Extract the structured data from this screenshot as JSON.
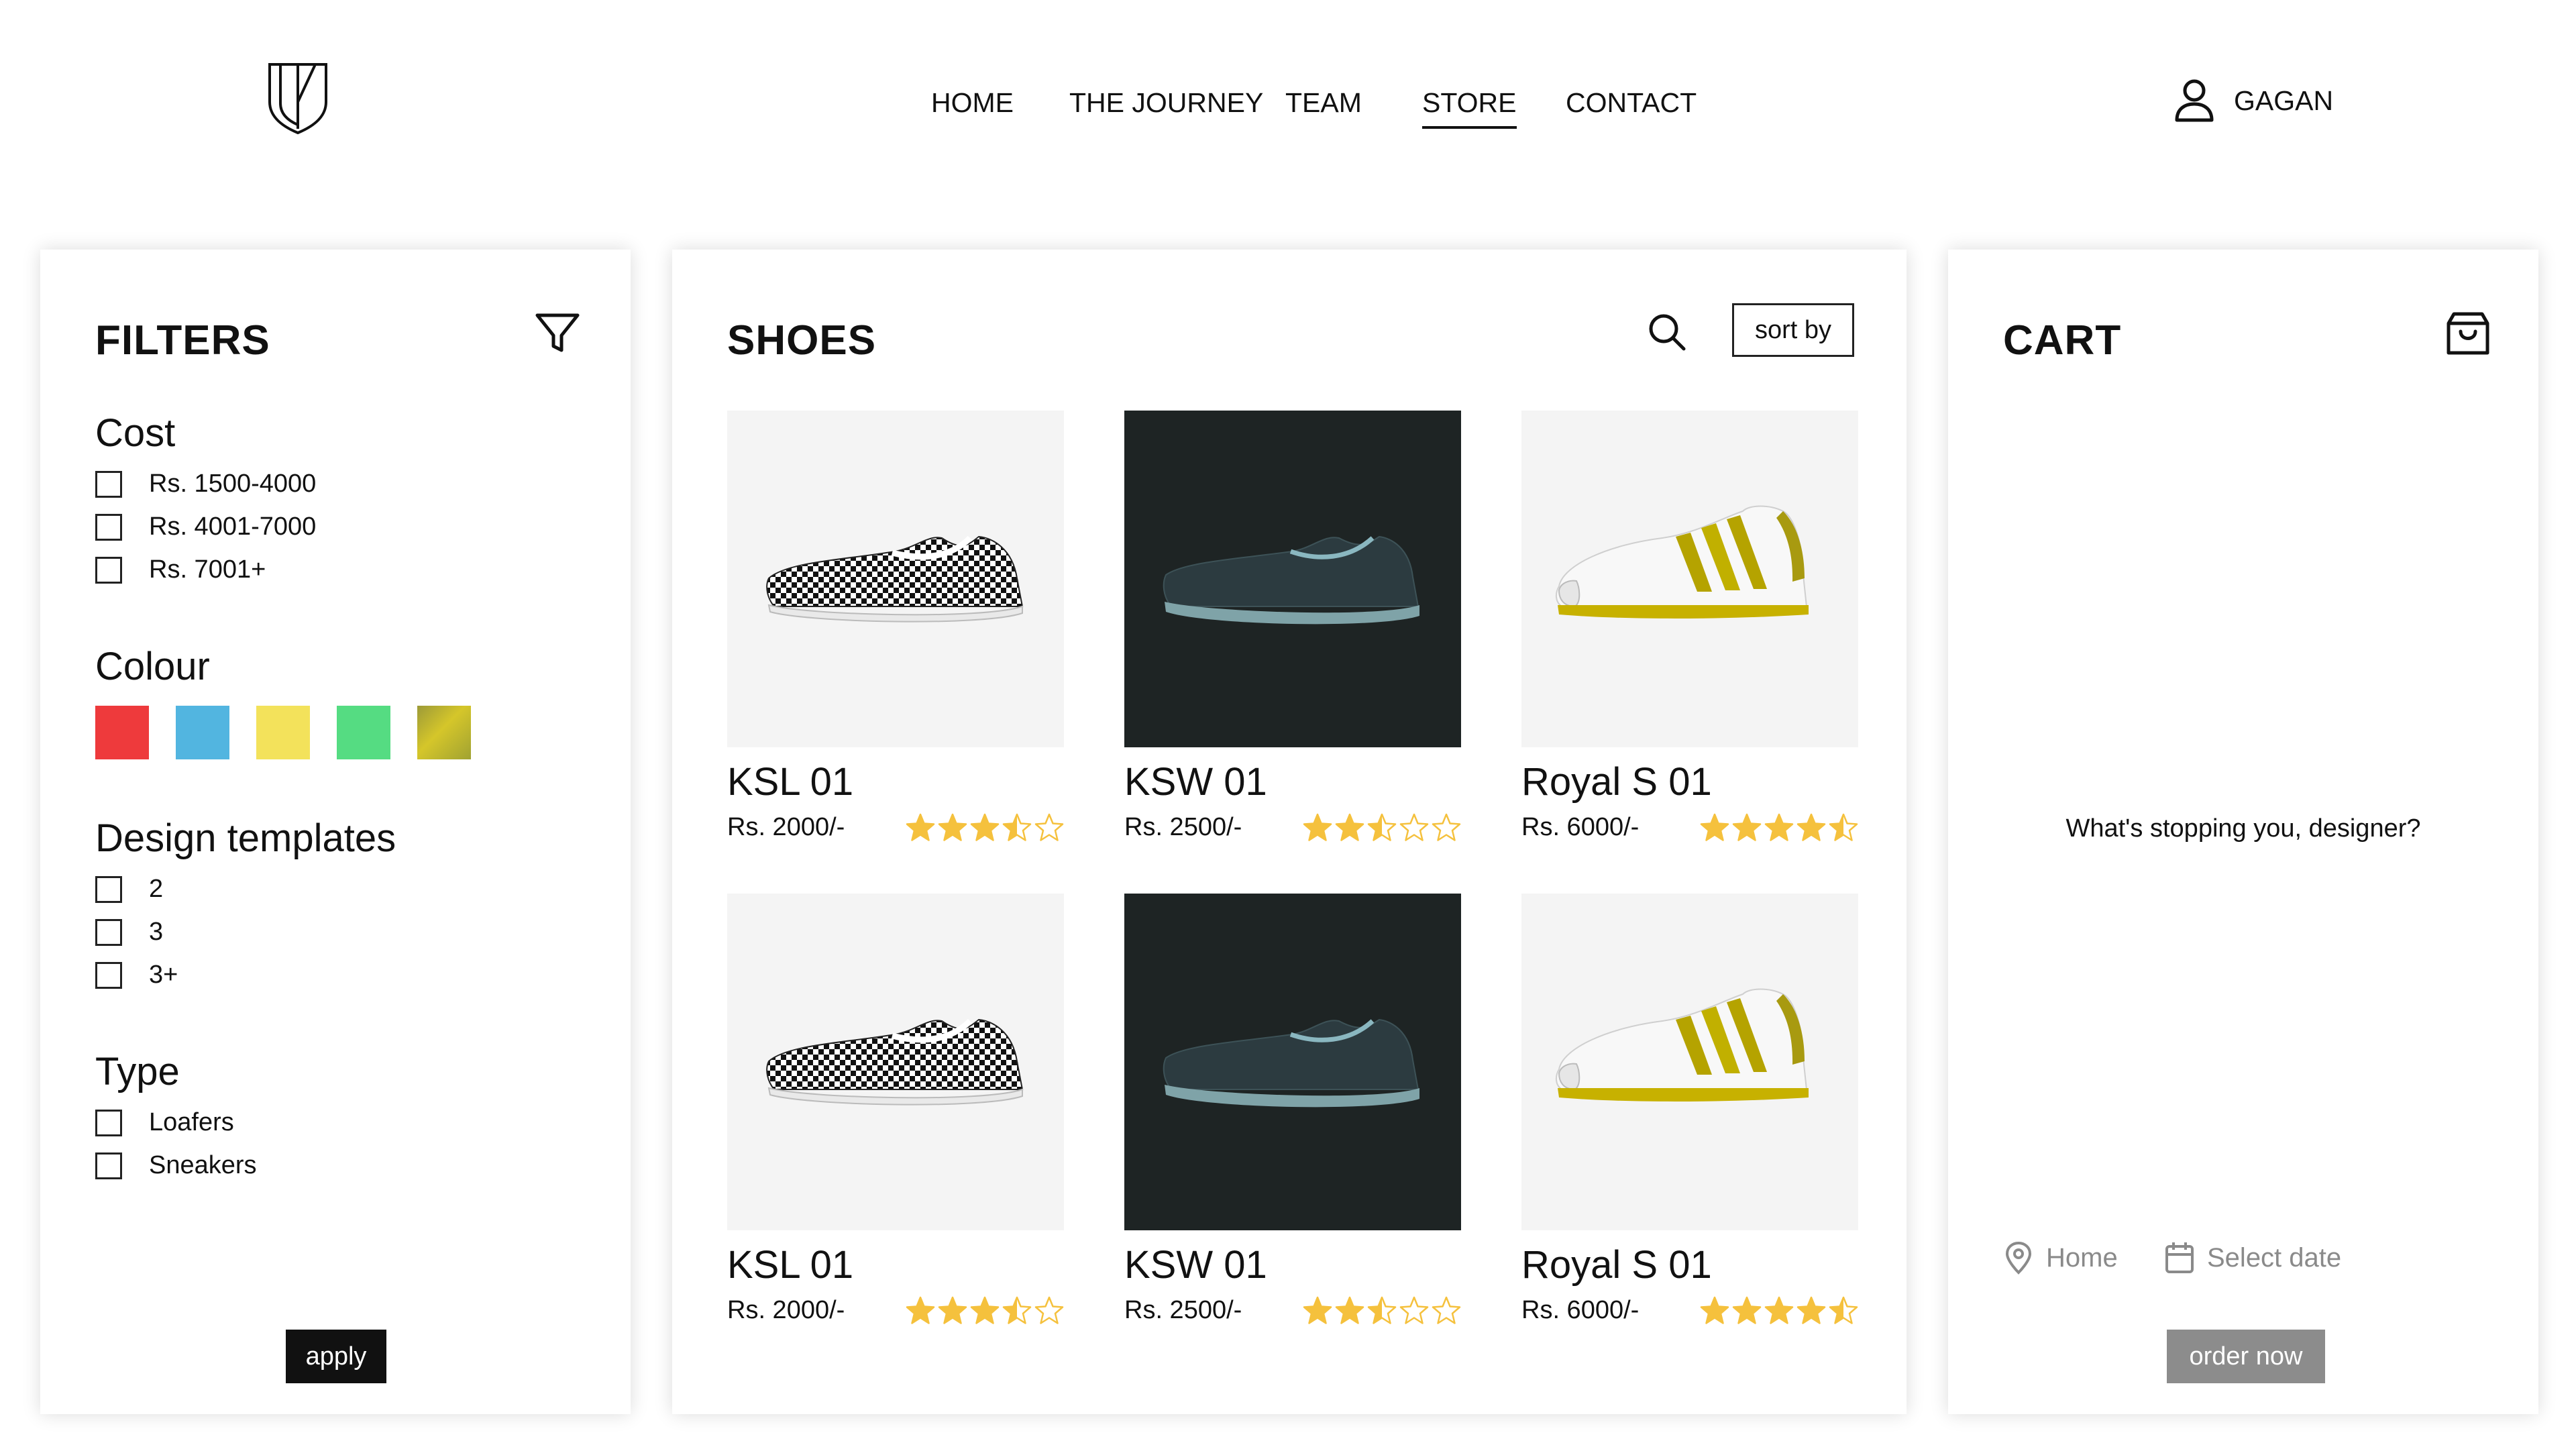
{
  "header": {
    "logo_icon": "shield-logo-icon",
    "nav": [
      {
        "label": "HOME",
        "active": false
      },
      {
        "label": "THE JOURNEY",
        "active": false
      },
      {
        "label": "TEAM",
        "active": false
      },
      {
        "label": "STORE",
        "active": true
      },
      {
        "label": "CONTACT",
        "active": false
      }
    ],
    "user": {
      "icon": "user-icon",
      "name": "GAGAN"
    }
  },
  "filters": {
    "title": "FILTERS",
    "icon": "filter-icon",
    "cost": {
      "title": "Cost",
      "options": [
        "Rs. 1500-4000",
        "Rs. 4001-7000",
        "Rs. 7001+"
      ]
    },
    "colour": {
      "title": "Colour",
      "swatches": [
        "#ee3a3c",
        "#52b5e0",
        "#f3e25b",
        "#55dc82",
        "gradient-olive-yellow"
      ]
    },
    "design_templates": {
      "title": "Design templates",
      "options": [
        "2",
        "3",
        "3+"
      ]
    },
    "type": {
      "title": "Type",
      "options": [
        "Loafers",
        "Sneakers"
      ]
    },
    "apply_label": "apply"
  },
  "shoes": {
    "title": "SHOES",
    "search_icon": "search-icon",
    "sort_label": "sort by",
    "products": [
      {
        "name": "KSL 01",
        "price": "Rs. 2000/-",
        "rating": 3.5,
        "image": "checkered-slip-on-shoe",
        "bg": "#f4f4f4"
      },
      {
        "name": "KSW 01",
        "price": "Rs. 2500/-",
        "rating": 2.5,
        "image": "dark-slate-slip-on-shoe",
        "bg": "#1e2424"
      },
      {
        "name": "Royal S 01",
        "price": "Rs. 6000/-",
        "rating": 4.5,
        "image": "white-gold-stripe-sneaker",
        "bg": "#f4f4f4"
      },
      {
        "name": "KSL 01",
        "price": "Rs. 2000/-",
        "rating": 3.5,
        "image": "checkered-slip-on-shoe",
        "bg": "#f4f4f4"
      },
      {
        "name": "KSW 01",
        "price": "Rs. 2500/-",
        "rating": 2.5,
        "image": "dark-slate-slip-on-shoe",
        "bg": "#1e2424"
      },
      {
        "name": "Royal S 01",
        "price": "Rs. 6000/-",
        "rating": 4.5,
        "image": "white-gold-stripe-sneaker",
        "bg": "#f4f4f4"
      }
    ],
    "star_color": "#f5c13d"
  },
  "cart": {
    "title": "CART",
    "icon": "shopping-bag-icon",
    "empty_message": "What's stopping you, designer?",
    "location": {
      "icon": "location-pin-icon",
      "label": "Home"
    },
    "date": {
      "icon": "calendar-icon",
      "label": "Select date"
    },
    "order_label": "order now"
  }
}
